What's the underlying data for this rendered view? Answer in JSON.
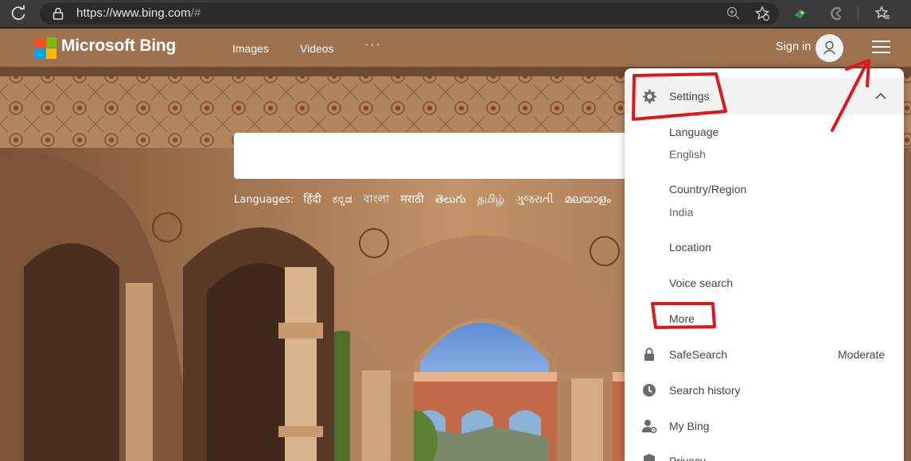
{
  "browser": {
    "url_main": "https://www.bing.com",
    "url_suffix": "/#"
  },
  "header": {
    "brand": "Microsoft Bing",
    "nav": [
      "Images",
      "Videos"
    ],
    "more": "···",
    "sign_in": "Sign in"
  },
  "search": {
    "languages_label": "Languages:",
    "languages": [
      "हिंदी",
      "ಕನ್ನಡ",
      "বাংলা",
      "मराठी",
      "తెలుగు",
      "தமிழ்",
      "ગુજરાતી",
      "മലയാളം"
    ]
  },
  "settings_panel": {
    "settings": "Settings",
    "language_label": "Language",
    "language_value": "English",
    "country_label": "Country/Region",
    "country_value": "India",
    "location": "Location",
    "voice_search": "Voice search",
    "more": "More",
    "safesearch": "SafeSearch",
    "safesearch_value": "Moderate",
    "search_history": "Search history",
    "my_bing": "My Bing",
    "privacy": "Privacy"
  },
  "colors": {
    "annotation": "#e0161b",
    "logo": [
      "#f25022",
      "#7fba00",
      "#00a4ef",
      "#ffb900"
    ]
  }
}
